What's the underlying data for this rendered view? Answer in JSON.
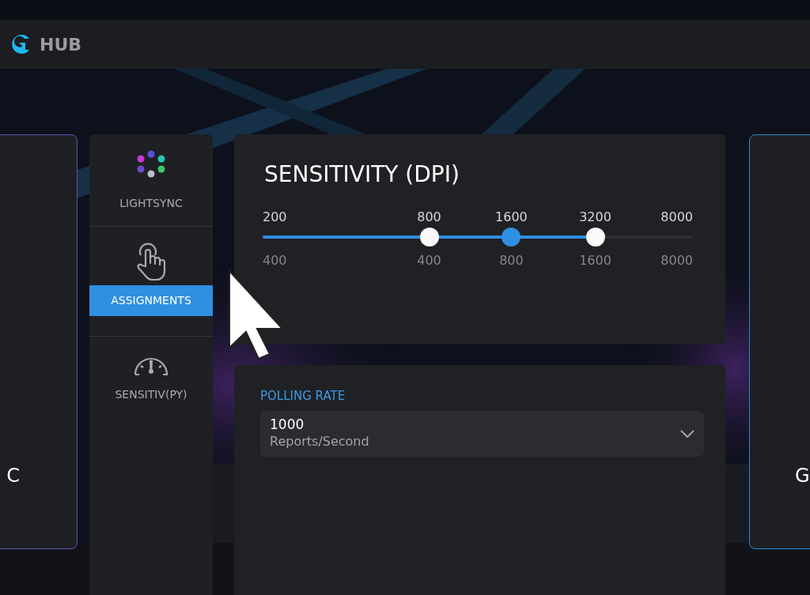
{
  "app": {
    "title": "HUB"
  },
  "side_cards": [
    {
      "text": "C",
      "kind": "left"
    },
    {
      "text": "G",
      "kind": "right"
    }
  ],
  "sidebar": {
    "items": [
      {
        "label": "LIGHTSYNC",
        "selected": false
      },
      {
        "label": "ASSIGNMENTS",
        "selected": true
      },
      {
        "label": "SENSITIV(PY)",
        "selected": false
      }
    ]
  },
  "sensitivity": {
    "title": "SENSITIVITY (DPI)",
    "level": 0.773,
    "stages": [
      {
        "label": "200",
        "sub_label": "400",
        "kind": "start"
      },
      {
        "label": "800",
        "sub_label": "400",
        "kind": "thumb",
        "level": 0.387,
        "selected": false
      },
      {
        "label": "1600",
        "sub_label": "800",
        "kind": "thumb",
        "level": 0.578,
        "selected": true
      },
      {
        "label": "3200",
        "sub_label": "1600",
        "kind": "thumb",
        "level": 0.773,
        "selected": false
      },
      {
        "label": "8000",
        "sub_label": "8000",
        "kind": "end"
      }
    ]
  },
  "polling": {
    "label": "POLLING RATE",
    "value": "1000",
    "unit": "Reports/Second"
  }
}
